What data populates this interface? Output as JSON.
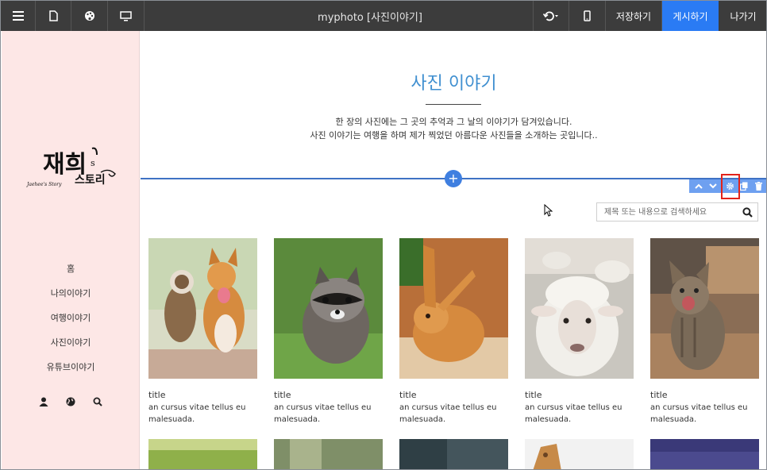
{
  "topbar": {
    "title": "myphoto [사진이야기]",
    "save_label": "저장하기",
    "publish_label": "게시하기",
    "exit_label": "나가기",
    "icons": [
      "menu-icon",
      "page-icon",
      "palette-icon",
      "desktop-icon",
      "undo-icon",
      "mobile-icon"
    ]
  },
  "sidebar": {
    "logo_alt": "재희's 스토리",
    "nav": [
      "홈",
      "나의이야기",
      "여행이야기",
      "사진이야기",
      "유튜브이야기"
    ],
    "icons": [
      "user-icon",
      "globe-icon",
      "search-icon"
    ]
  },
  "hero": {
    "title": "사진 이야기",
    "desc_line1": "한 장의 사진에는 그 곳의 추억과 그 날의 이야기가 담겨있습니다.",
    "desc_line2": "사진 이야기는 여행을 하며 제가 찍었던 아름다운 사진들을 소개하는 곳입니다.."
  },
  "search": {
    "placeholder": "제목 또는 내용으로 검색하세요"
  },
  "cards": [
    {
      "title": "title",
      "desc": "an cursus vitae tellus eu malesuada.",
      "subject": "dogs"
    },
    {
      "title": "title",
      "desc": "an cursus vitae tellus eu malesuada.",
      "subject": "raccoon"
    },
    {
      "title": "title",
      "desc": "an cursus vitae tellus eu malesuada.",
      "subject": "rabbit"
    },
    {
      "title": "title",
      "desc": "an cursus vitae tellus eu malesuada.",
      "subject": "sheep"
    },
    {
      "title": "title",
      "desc": "an cursus vitae tellus eu malesuada.",
      "subject": "kitten"
    }
  ],
  "colors": {
    "topbar": "#3c3c3c",
    "publish": "#2a7bf4",
    "sidebar": "#fde7e6",
    "accent": "#3f8fd0",
    "section_toolbar": "#6ea0f0",
    "highlight": "#e2231a"
  }
}
